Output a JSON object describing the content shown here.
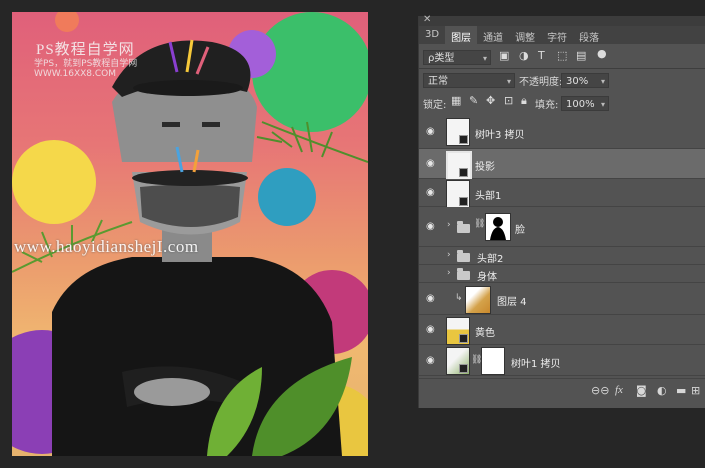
{
  "canvas": {
    "watermark_title": "PS教程自学网",
    "watermark_sub": "学PS，就到PS教程自学网",
    "watermark_sub2": "WWW.16XX8.COM",
    "overlay_url": "www.haoyidianshejI.com"
  },
  "panel": {
    "close_glyph": "✕",
    "tabs": [
      {
        "label": "3D",
        "active": false
      },
      {
        "label": "图层",
        "active": true
      },
      {
        "label": "通道",
        "active": false
      },
      {
        "label": "调整",
        "active": false
      },
      {
        "label": "字符",
        "active": false
      },
      {
        "label": "段落",
        "active": false
      }
    ],
    "filter": {
      "kind_label": "ρ类型"
    },
    "blend_mode": "正常",
    "opacity": {
      "label": "不透明度:",
      "value": "30%"
    },
    "lock_label": "锁定:",
    "fill": {
      "label": "填充:",
      "value": "100%"
    },
    "layers": [
      {
        "name": "树叶3 拷贝"
      },
      {
        "name": "投影"
      },
      {
        "name": "头部1"
      },
      {
        "name": "脸"
      },
      {
        "name": "头部2"
      },
      {
        "name": "身体"
      },
      {
        "name": "图层 4"
      },
      {
        "name": "黄色"
      },
      {
        "name": "树叶1 拷贝"
      }
    ],
    "bottom_icons": [
      "link-icon",
      "fx-icon",
      "mask-icon",
      "adjustment-icon",
      "group-icon",
      "new-layer-icon",
      "trash-icon"
    ],
    "bottom_labels": {
      "fx": "fx"
    }
  },
  "colors": {
    "panel_bg": "#535353",
    "selected_row": "#6b6b6b",
    "app_bg": "#262626"
  }
}
